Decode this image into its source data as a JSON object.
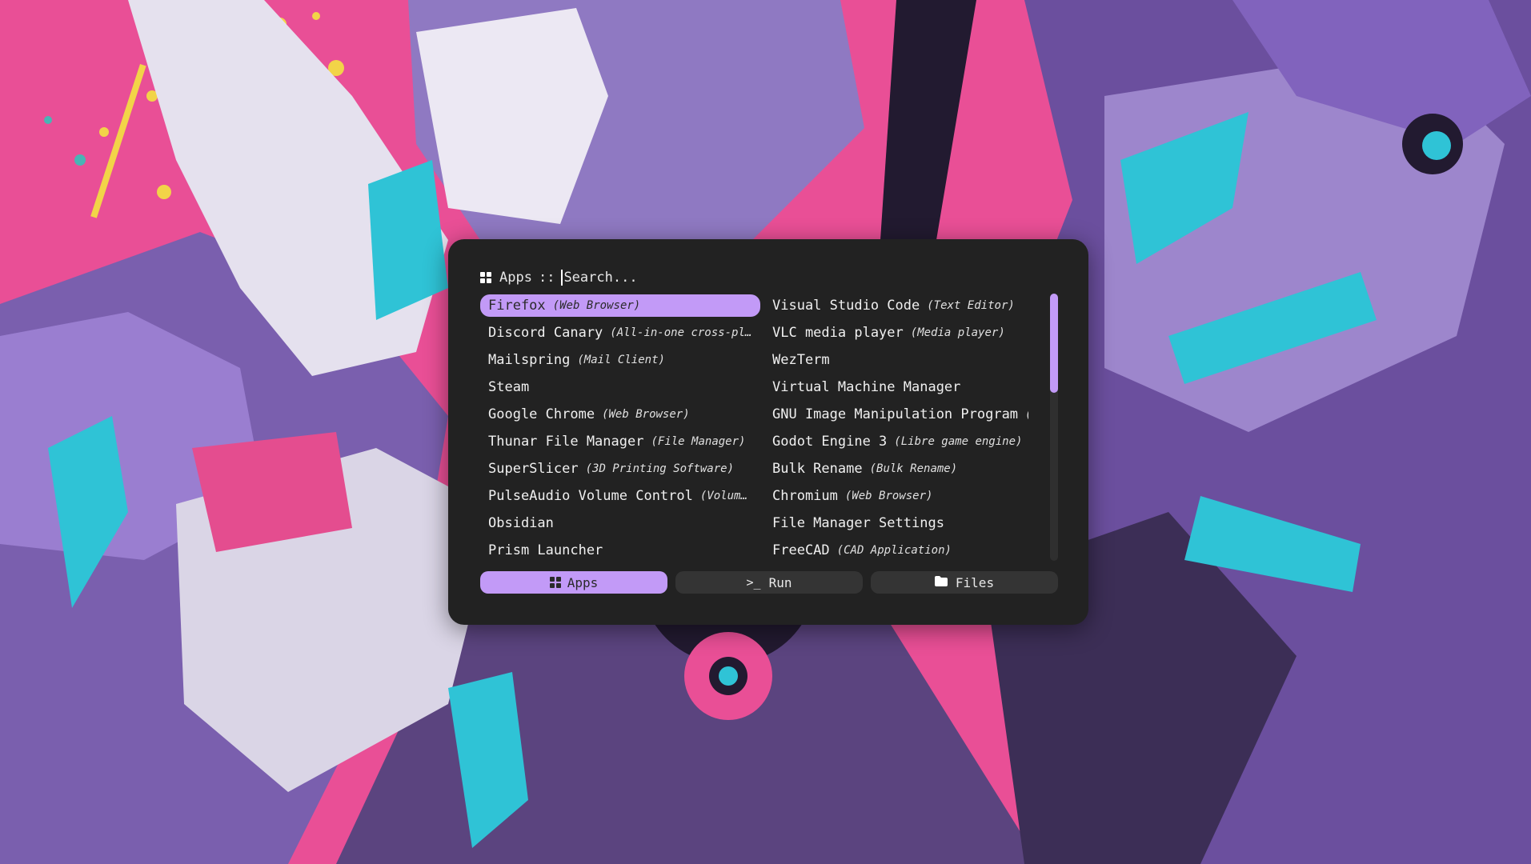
{
  "colors": {
    "accent": "#c29af7",
    "panel": "#222222",
    "wallpaper_pink": "#e94f96",
    "wallpaper_purple": "#6b4f9e",
    "wallpaper_cyan": "#2fc3d6"
  },
  "prompt": {
    "mode_label": "Apps",
    "separator": "::",
    "placeholder": "Search...",
    "value": "",
    "icon": "grid-icon"
  },
  "apps": {
    "left": [
      {
        "name": "Firefox",
        "desc": "(Web Browser)",
        "selected": true
      },
      {
        "name": "Discord Canary",
        "desc": "(All-in-one cross-pla…"
      },
      {
        "name": "Mailspring",
        "desc": "(Mail Client)"
      },
      {
        "name": "Steam",
        "desc": ""
      },
      {
        "name": "Google Chrome",
        "desc": "(Web Browser)"
      },
      {
        "name": "Thunar File Manager",
        "desc": "(File Manager)"
      },
      {
        "name": "SuperSlicer",
        "desc": "(3D Printing Software)"
      },
      {
        "name": "PulseAudio Volume Control",
        "desc": "(Volume…"
      },
      {
        "name": "Obsidian",
        "desc": ""
      },
      {
        "name": "Prism Launcher",
        "desc": ""
      }
    ],
    "right": [
      {
        "name": "Visual Studio Code",
        "desc": "(Text Editor)"
      },
      {
        "name": "VLC media player",
        "desc": "(Media player)"
      },
      {
        "name": "WezTerm",
        "desc": ""
      },
      {
        "name": "Virtual Machine Manager",
        "desc": ""
      },
      {
        "name": "GNU Image Manipulation Program",
        "desc": "(…"
      },
      {
        "name": "Godot Engine 3",
        "desc": "(Libre game engine)"
      },
      {
        "name": "Bulk Rename",
        "desc": "(Bulk Rename)"
      },
      {
        "name": "Chromium",
        "desc": "(Web Browser)"
      },
      {
        "name": "File Manager Settings",
        "desc": ""
      },
      {
        "name": "FreeCAD",
        "desc": "(CAD Application)"
      }
    ]
  },
  "modes": [
    {
      "label": "Apps",
      "icon": "grid-icon",
      "active": true
    },
    {
      "label": "Run",
      "icon": "terminal-icon",
      "active": false
    },
    {
      "label": "Files",
      "icon": "folder-icon",
      "active": false
    }
  ]
}
